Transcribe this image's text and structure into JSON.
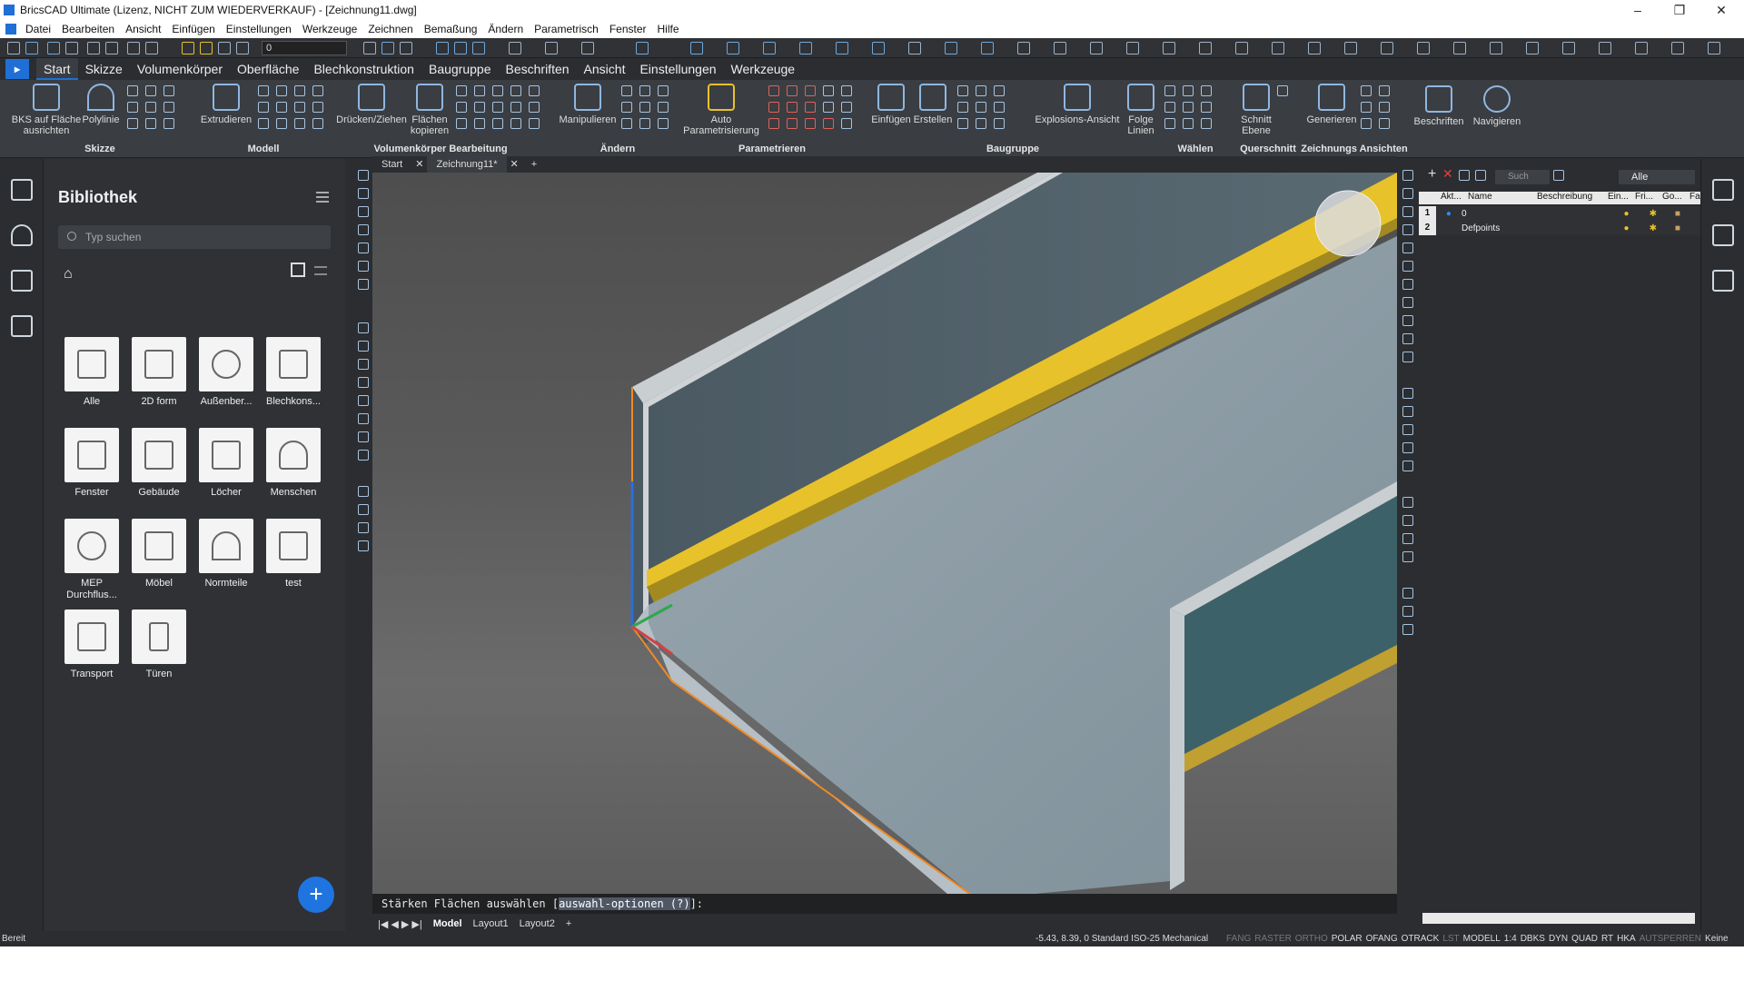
{
  "title": "BricsCAD Ultimate (Lizenz, NICHT ZUM WIEDERVERKAUF) - [Zeichnung11.dwg]",
  "window_controls": [
    "–",
    "❐",
    "✕"
  ],
  "menu": [
    "Datei",
    "Bearbeiten",
    "Ansicht",
    "Einfügen",
    "Einstellungen",
    "Werkzeuge",
    "Zeichnen",
    "Bemaßung",
    "Ändern",
    "Parametrisch",
    "Fenster",
    "Hilfe"
  ],
  "qat": {
    "current_layer": "0"
  },
  "ribbon_tabs": [
    "Start",
    "Skizze",
    "Volumenkörper",
    "Oberfläche",
    "Blechkonstruktion",
    "Baugruppe",
    "Beschriften",
    "Ansicht",
    "Einstellungen",
    "Werkzeuge"
  ],
  "ribbon_tools": {
    "bks": "BKS auf Fläche ausrichten",
    "polyline": "Polylinie",
    "extrude": "Extrudieren",
    "push_pull": "Drücken/Ziehen",
    "copy_faces": "Flächen kopieren",
    "manipulate": "Manipulieren",
    "auto_param": "Auto Parametrisierung",
    "insert": "Einfügen",
    "create": "Erstellen",
    "explode_view": "Explosions-Ansicht",
    "follow_lines": "Folge Linien",
    "section_plane": "Schnitt Ebene",
    "generate": "Generieren",
    "annotate": "Beschriften",
    "navigate": "Navigieren"
  },
  "ribbon_groups": {
    "sketch": "Skizze",
    "model": "Modell",
    "solid_edit": "Volumenkörper Bearbeitung",
    "modify": "Ändern",
    "parametrize": "Parametrieren",
    "assembly": "Baugruppe",
    "select": "Wählen",
    "section": "Querschnitt",
    "drawing_views": "Zeichnungs Ansichten"
  },
  "library": {
    "title": "Bibliothek",
    "search_placeholder": "Typ suchen",
    "home_icon": "⌂",
    "add_button": "+",
    "items": [
      {
        "label": "Alle"
      },
      {
        "label": "2D form"
      },
      {
        "label": "Außenber..."
      },
      {
        "label": "Blechkons..."
      },
      {
        "label": "Fenster"
      },
      {
        "label": "Gebäude"
      },
      {
        "label": "Löcher"
      },
      {
        "label": "Menschen"
      },
      {
        "label": "MEP Durchflus..."
      },
      {
        "label": "Möbel"
      },
      {
        "label": "Normteile"
      },
      {
        "label": "test"
      },
      {
        "label": "Transport"
      },
      {
        "label": "Türen"
      }
    ]
  },
  "doc_tabs": {
    "start": "Start",
    "drawing": "Zeichnung11*",
    "close": "✕",
    "add": "+"
  },
  "command": {
    "prompt": "Stärken Flächen auswählen [",
    "option": "auswahl-optionen (?)",
    "suffix": "]:"
  },
  "layout_tabs": [
    "Model",
    "Layout1",
    "Layout2",
    "+"
  ],
  "layers": {
    "filter": "Alle",
    "search_placeholder": "Such",
    "columns": [
      "Akt...",
      "Name",
      "Beschreibung",
      "Ein...",
      "Fri...",
      "Go...",
      "Fa"
    ],
    "rows": [
      {
        "num": "1",
        "name": "0"
      },
      {
        "num": "2",
        "name": "Defpoints"
      }
    ]
  },
  "status": {
    "ready": "Bereit",
    "coords": "-5.43, 8.39, 0",
    "style": "Standard",
    "dimstyle": "ISO-25",
    "workspace": "Mechanical",
    "modes": [
      {
        "label": "FANG",
        "on": false
      },
      {
        "label": "RASTER",
        "on": false
      },
      {
        "label": "ORTHO",
        "on": false
      },
      {
        "label": "POLAR",
        "on": true
      },
      {
        "label": "OFANG",
        "on": true
      },
      {
        "label": "OTRACK",
        "on": true
      },
      {
        "label": "LST",
        "on": false
      },
      {
        "label": "MODELL",
        "on": true
      },
      {
        "label": "1:4",
        "on": true
      },
      {
        "label": "DBKS",
        "on": true
      },
      {
        "label": "DYN",
        "on": true
      },
      {
        "label": "QUAD",
        "on": true
      },
      {
        "label": "RT",
        "on": true
      },
      {
        "label": "HKA",
        "on": true
      },
      {
        "label": "AUTSPERREN",
        "on": false
      },
      {
        "label": "Keine",
        "on": true
      }
    ]
  },
  "colors": {
    "accent": "#1f6fd6",
    "model_face": "#8f9ea8",
    "model_dark": "#4a5a63",
    "model_edge_yellow": "#e8c22a",
    "selection_orange": "#f08a24"
  }
}
